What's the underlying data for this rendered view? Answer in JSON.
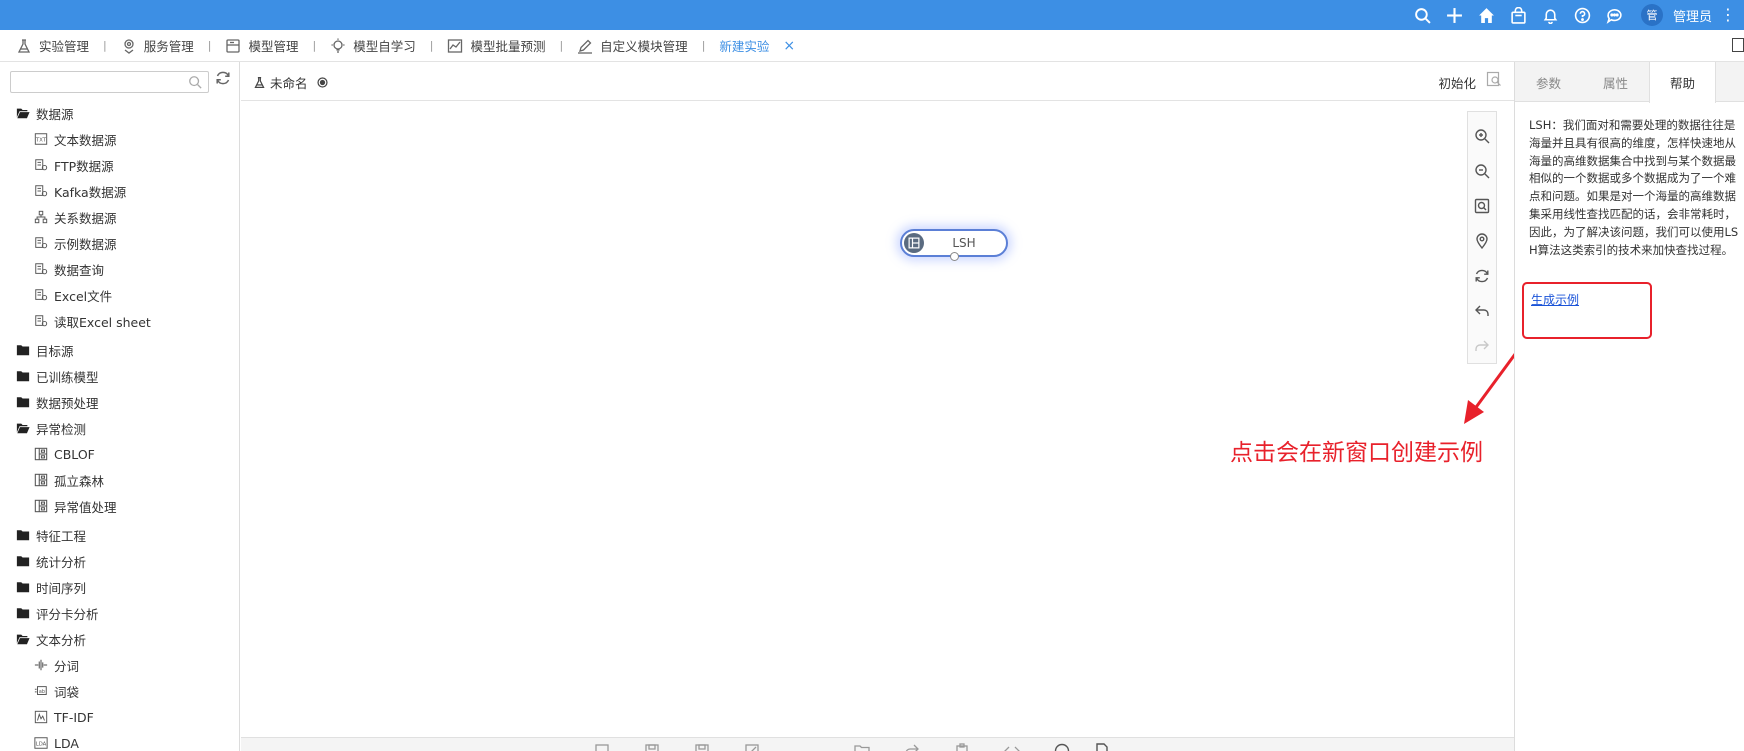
{
  "topbar": {
    "icons": [
      "search-icon",
      "plus-icon",
      "home-icon",
      "bag-icon",
      "bell-icon",
      "help-icon",
      "chat-icon"
    ],
    "avatar_text": "管",
    "user_name": "管理员",
    "more": "⋮",
    "bg_color": "#3d8fe4"
  },
  "tabs": [
    {
      "label": "实验管理",
      "icon": "flask-icon"
    },
    {
      "label": "服务管理",
      "icon": "service-icon"
    },
    {
      "label": "模型管理",
      "icon": "model-icon"
    },
    {
      "label": "模型自学习",
      "icon": "bulb-icon"
    },
    {
      "label": "模型批量预测",
      "icon": "chart-icon"
    },
    {
      "label": "自定义模块管理",
      "icon": "pen-icon"
    },
    {
      "label": "新建实验",
      "icon": "",
      "active": true,
      "closable": true
    }
  ],
  "tab_sep": "|",
  "tab_close": "×",
  "sidebar": {
    "search_placeholder": "",
    "tree": [
      {
        "label": "数据源",
        "type": "folder",
        "open": true
      },
      {
        "label": "文本数据源",
        "type": "leaf",
        "icon": "txt-icon"
      },
      {
        "label": "FTP数据源",
        "type": "leaf",
        "icon": "db-icon"
      },
      {
        "label": "Kafka数据源",
        "type": "leaf",
        "icon": "db-icon"
      },
      {
        "label": "关系数据源",
        "type": "leaf",
        "icon": "relation-icon"
      },
      {
        "label": "示例数据源",
        "type": "leaf",
        "icon": "db-icon"
      },
      {
        "label": "数据查询",
        "type": "leaf",
        "icon": "db-icon"
      },
      {
        "label": "Excel文件",
        "type": "leaf",
        "icon": "db-icon"
      },
      {
        "label": "读取Excel sheet",
        "type": "leaf",
        "icon": "db-icon"
      },
      {
        "label": "目标源",
        "type": "folder"
      },
      {
        "label": "已训练模型",
        "type": "folder"
      },
      {
        "label": "数据预处理",
        "type": "folder"
      },
      {
        "label": "异常检测",
        "type": "folder",
        "open": true
      },
      {
        "label": "CBLOF",
        "type": "leaf",
        "icon": "module-icon"
      },
      {
        "label": "孤立森林",
        "type": "leaf",
        "icon": "module-icon"
      },
      {
        "label": "异常值处理",
        "type": "leaf",
        "icon": "module-icon"
      },
      {
        "label": "特征工程",
        "type": "folder"
      },
      {
        "label": "统计分析",
        "type": "folder"
      },
      {
        "label": "时间序列",
        "type": "folder"
      },
      {
        "label": "评分卡分析",
        "type": "folder"
      },
      {
        "label": "文本分析",
        "type": "folder",
        "open": true
      },
      {
        "label": "分词",
        "type": "leaf",
        "icon": "split-icon"
      },
      {
        "label": "词袋",
        "type": "leaf",
        "icon": "bag-words-icon"
      },
      {
        "label": "TF-IDF",
        "type": "leaf",
        "icon": "tfidf-icon"
      },
      {
        "label": "LDA",
        "type": "leaf",
        "icon": "lda-icon"
      }
    ]
  },
  "canvas_header": {
    "experiment_name": "未命名",
    "init_label": "初始化"
  },
  "canvas": {
    "node_label": "LSH",
    "annotation": "点击会在新窗口创建示例",
    "annotation_color": "#e8212b"
  },
  "right_panel": {
    "tabs": [
      {
        "label": "参数"
      },
      {
        "label": "属性"
      },
      {
        "label": "帮助",
        "active": true
      }
    ],
    "help_text": "LSH：我们面对和需要处理的数据往往是海量并且具有很高的维度，怎样快速地从海量的高维数据集合中找到与某个数据最相似的一个数据或多个数据成为了一个难点和问题。如果是对一个海量的高维数据集采用线性查找匹配的话，会非常耗时，因此，为了解决该问题，我们可以使用LSH算法这类索引的技术来加快查找过程。",
    "help_link": "生成示例"
  }
}
